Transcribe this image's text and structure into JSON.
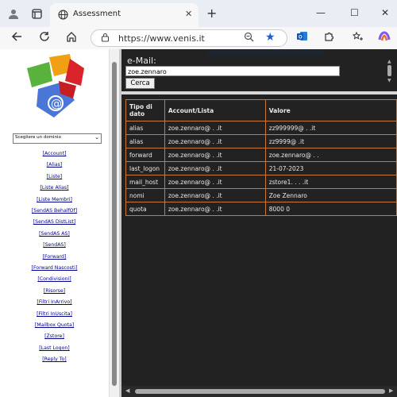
{
  "browser": {
    "tab_title": "Assessment",
    "url": "https://www.venis.it",
    "new_tab_symbol": "+",
    "close_symbol": "✕",
    "win_min": "—",
    "win_max": "☐",
    "win_close": "✕"
  },
  "sidebar": {
    "domain_select": "Scegliere un dominio",
    "links": [
      "[Account]",
      "[Alias]",
      "[Liste]",
      "[Liste Alias]",
      "[Liste Membri]",
      "[SendAS BehalfOf]",
      "[SendAS DistList]",
      "[SendAS AS]",
      "[SendAS]",
      "[Forward]",
      "[Forward Nascosti]",
      "[Condivisioni]",
      "[Risorse]",
      "[Filtri InArrivo]",
      "[Filtri InUscita]",
      "[Mailbox Quota]",
      "[Zstore]",
      "[Last Logon]",
      "[Reply To]"
    ]
  },
  "search": {
    "label": "e-Mail:",
    "value": "zoe.zennaro",
    "button": "Cerca"
  },
  "table": {
    "headers": [
      "Tipo di dato",
      "Account/Lista",
      "Valore"
    ],
    "rows": [
      [
        "alias",
        "zoe.zennaro@          .          .it",
        "zz999999@          .          .it"
      ],
      [
        "alias",
        "zoe.zennaro@          .          .it",
        "zz9999@       .it"
      ],
      [
        "forward",
        "zoe.zennaro@          .          .it",
        "zoe.zennaro@               .            ."
      ],
      [
        "last_logon",
        "zoe.zennaro@          .          .it",
        "21-07-2023"
      ],
      [
        "mail_host",
        "zoe.zennaro@          .          .it",
        "zstore1.          .          .          .it"
      ],
      [
        "nomi",
        "zoe.zennaro@          .          .it",
        "Zoe Zennaro"
      ],
      [
        "quota",
        "zoe.zennaro@          .          .it",
        "8000 0"
      ]
    ]
  }
}
